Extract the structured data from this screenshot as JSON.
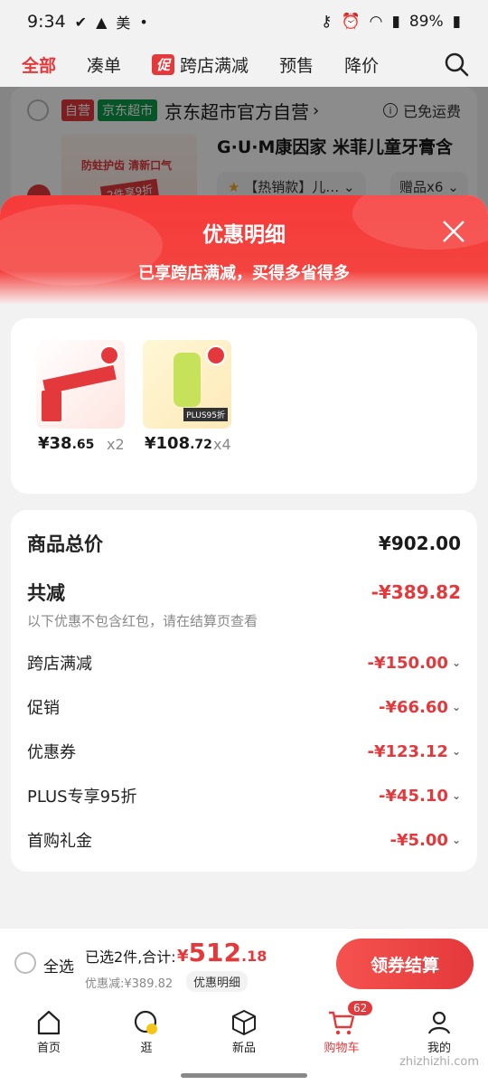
{
  "status_bar": {
    "time": "9:34",
    "carrier_glyph": "美",
    "battery": "89%"
  },
  "tabs": [
    {
      "label": "全部",
      "active": true
    },
    {
      "label": "凑单"
    },
    {
      "label": "跨店满减",
      "badge": "促"
    },
    {
      "label": "预售"
    },
    {
      "label": "降价"
    }
  ],
  "store": {
    "tag_self": "自营",
    "tag_market": "京东超市",
    "name": "京东超市官方自营",
    "free_shipping": "已免运费",
    "product_title": "G·U·M康因家 米菲儿童牙膏含",
    "product_img_text": "防蛀护齿 清新口气",
    "product_img_promo": "2件享9折",
    "spec": "【热销款】儿…",
    "gift": "赠品x6"
  },
  "modal": {
    "title": "优惠明细",
    "subtitle": "已享跨店满减，买得多省得多",
    "products": [
      {
        "price_int": "¥38",
        "price_dec": ".65",
        "qty": "x2",
        "thumb_label": ""
      },
      {
        "price_int": "¥108",
        "price_dec": ".72",
        "qty": "x4",
        "thumb_label": "PLUS95折"
      }
    ],
    "total_label": "商品总价",
    "total_value": "¥902.00",
    "save_label": "共减",
    "save_value": "-¥389.82",
    "note": "以下优惠不包含红包，请在结算页查看",
    "items": [
      {
        "label": "跨店满减",
        "value": "-¥150.00"
      },
      {
        "label": "促销",
        "value": "-¥66.60"
      },
      {
        "label": "优惠券",
        "value": "-¥123.12"
      },
      {
        "label": "PLUS专享95折",
        "value": "-¥45.10"
      },
      {
        "label": "首购礼金",
        "value": "-¥5.00"
      }
    ]
  },
  "checkout": {
    "select_all": "全选",
    "selected": "已选2件,合计:",
    "yen": "¥",
    "amount_int": "512",
    "amount_dec": ".18",
    "discount": "优惠减:¥389.82",
    "detail_btn": "优惠明细",
    "pay_btn": "领券结算"
  },
  "bottom_nav": [
    {
      "label": "首页",
      "icon": "home-icon"
    },
    {
      "label": "逛",
      "icon": "browse-icon"
    },
    {
      "label": "新品",
      "icon": "box-icon"
    },
    {
      "label": "购物车",
      "icon": "cart-icon",
      "badge": "62",
      "active": true
    },
    {
      "label": "我的",
      "icon": "user-icon"
    }
  ],
  "watermark": "zhizhizhi.com",
  "colors": {
    "accent": "#e4393c",
    "market_green": "#0e9a4a"
  }
}
